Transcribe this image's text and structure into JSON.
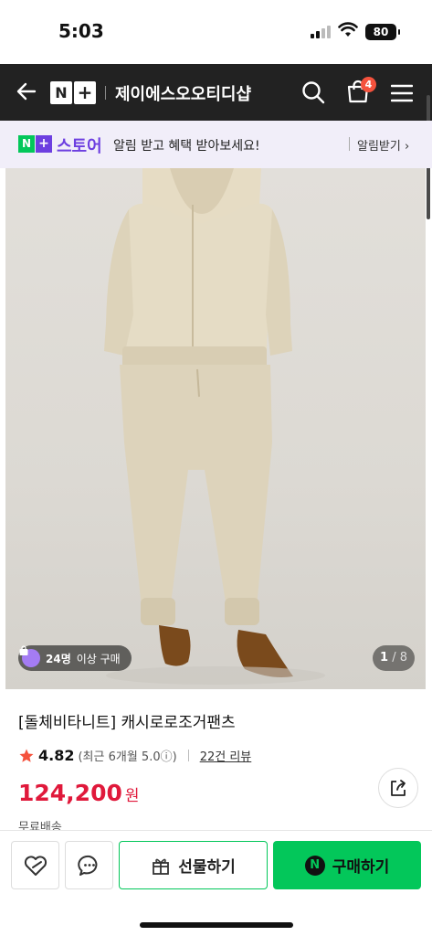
{
  "status_bar": {
    "time": "5:03",
    "battery": "80"
  },
  "header": {
    "logo_n": "N",
    "logo_plus": "+",
    "store_name": "제이에스오오티디샵",
    "cart_count": "4"
  },
  "notify_bar": {
    "logo_n": "N",
    "logo_plus": "+",
    "store_label": "스토어",
    "message": "알림 받고 혜택 받아보세요!",
    "button": "알림받기 ›"
  },
  "gallery": {
    "buyers_count": "24명",
    "buyers_suffix": "이상 구매",
    "page_current": "1",
    "page_total": "/ 8"
  },
  "product": {
    "title": "[돌체비타니트] 캐시로로조거팬츠",
    "rating": "4.82",
    "recent_rating": "(최근 6개월 5.0ⓘ)",
    "reviews": "22건 리뷰",
    "price": "124,200",
    "currency": "원",
    "shipping": "무료배송"
  },
  "bottom_bar": {
    "gift_label": "선물하기",
    "buy_n": "N",
    "buy_label": "구매하기"
  },
  "colors": {
    "naver_green": "#03c75a",
    "price_red": "#e0193b",
    "brand_purple": "#6d3fe0",
    "header_bg": "#222222",
    "badge_orange": "#f5523d"
  }
}
